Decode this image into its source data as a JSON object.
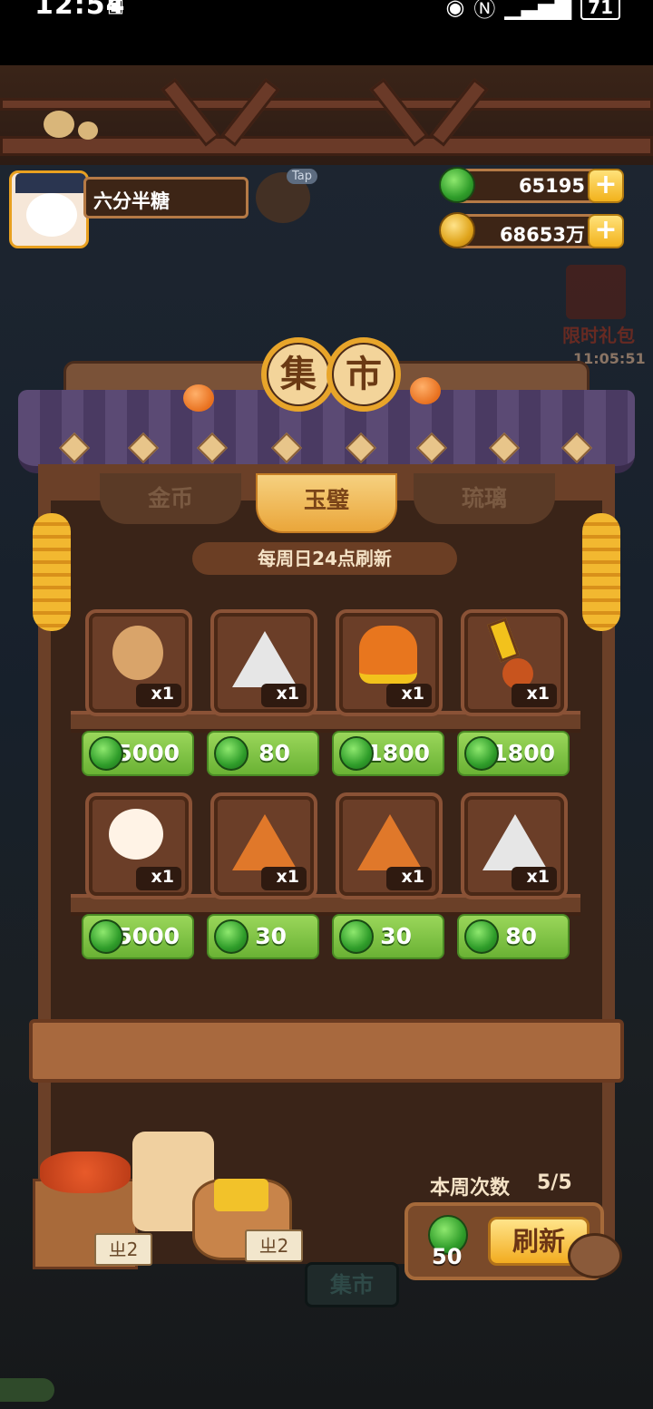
{
  "status_bar": {
    "time": "12:54",
    "battery": "71"
  },
  "player": {
    "name": "六分半糖",
    "tap_label": "Tap"
  },
  "currency": {
    "jade": "65195",
    "coins": "68653万",
    "plus": "+"
  },
  "gift": {
    "label": "限时礼包",
    "timer": "11:05:51"
  },
  "market": {
    "title_chars": [
      "集",
      "市"
    ],
    "tabs": [
      {
        "label": "金币",
        "active": false
      },
      {
        "label": "玉璧",
        "active": true
      },
      {
        "label": "琉璃",
        "active": false
      }
    ],
    "refresh_note": "每周日24点刷新",
    "items": [
      {
        "icon": "scarecrow-doll-icon",
        "qty": "x1",
        "price": "25000"
      },
      {
        "icon": "white-stone-tablet-icon",
        "qty": "x1",
        "price": "80"
      },
      {
        "icon": "orange-bell-icon",
        "qty": "x1",
        "price": "1800"
      },
      {
        "icon": "scroll-charm-icon",
        "qty": "x1",
        "price": "1800"
      },
      {
        "icon": "bear-musician-icon",
        "qty": "x1",
        "price": "25000"
      },
      {
        "icon": "orange-stone-tablet-icon",
        "qty": "x1",
        "price": "30"
      },
      {
        "icon": "orange-spiral-stone-icon",
        "qty": "x1",
        "price": "30"
      },
      {
        "icon": "white-bug-stone-icon",
        "qty": "x1",
        "price": "80"
      }
    ]
  },
  "refresh": {
    "week_label": "本周次数",
    "week_count": "5/5",
    "cost": "50",
    "button": "刷新"
  },
  "market_sign": "集市",
  "crate_labels": [
    "ㄓ2",
    "ㄓ2"
  ],
  "colors": {
    "jade": "#2f9d2a",
    "gold": "#f2b21c",
    "wood": "#6b4028",
    "price_green": "#6ab234"
  }
}
